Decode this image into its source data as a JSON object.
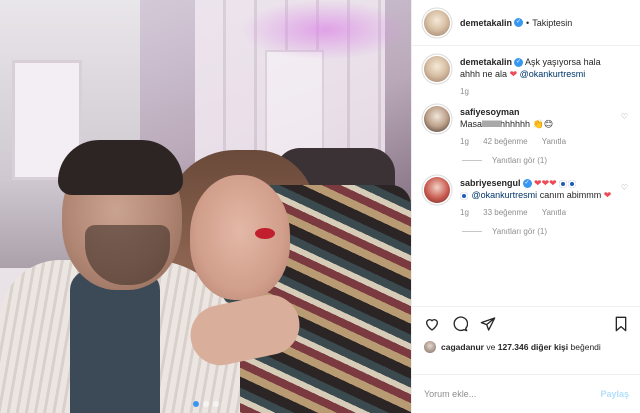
{
  "post": {
    "author": "demetakalin",
    "follow_status": "Takiptesin",
    "dot_separator": "•"
  },
  "caption": {
    "username": "demetakalin",
    "text": "Aşk yaşıyorsa hala ahhh ne ala",
    "mention": "@okankurtresmi",
    "time": "1g"
  },
  "comments": [
    {
      "username": "safiyesoyman",
      "text": "Masalllllllllhhhhhh",
      "time": "1g",
      "likes": "42 beğenme",
      "reply_label": "Yanıtla",
      "view_replies": "Yanıtları gör (1)"
    },
    {
      "username": "sabriyesengul",
      "mention": "@okankurtresmi",
      "text": "canım abimmm",
      "time": "1g",
      "likes": "33 beğenme",
      "reply_label": "Yanıtla",
      "view_replies": "Yanıtları gör (1)"
    }
  ],
  "likes_summary": {
    "first_liker": "cagadanur",
    "connector": "ve",
    "others": "127.346 diğer kişi",
    "suffix": "beğendi"
  },
  "comment_input": {
    "placeholder": "Yorum ekle...",
    "post_label": "Paylaş"
  },
  "colors": {
    "accent": "#3897f0",
    "heart": "#ed4956",
    "muted": "#8e8e8e"
  }
}
